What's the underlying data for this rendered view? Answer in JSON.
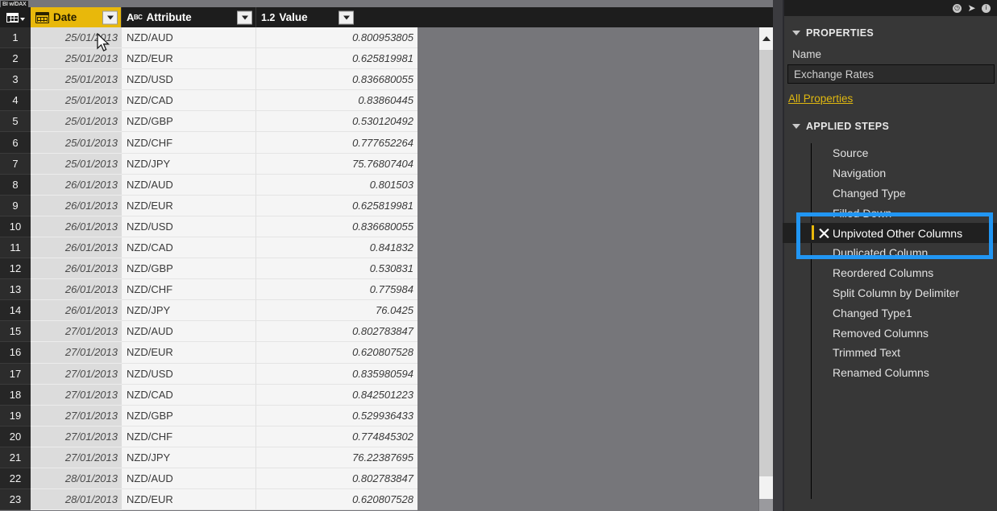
{
  "watermark": "BI w/DAX",
  "grid": {
    "columns": [
      {
        "name": "Date",
        "type_icon": "calendar-icon",
        "type_label": "",
        "selected": true
      },
      {
        "name": "Attribute",
        "type_icon": "abc-text-icon",
        "type_label": "ABC",
        "selected": false
      },
      {
        "name": "Value",
        "type_icon": "decimal-number-icon",
        "type_label": "1.2",
        "selected": false
      }
    ],
    "rows": [
      {
        "n": "1",
        "date": "25/01/2013",
        "attribute": "NZD/AUD",
        "value": "0.800953805"
      },
      {
        "n": "2",
        "date": "25/01/2013",
        "attribute": "NZD/EUR",
        "value": "0.625819981"
      },
      {
        "n": "3",
        "date": "25/01/2013",
        "attribute": "NZD/USD",
        "value": "0.836680055"
      },
      {
        "n": "4",
        "date": "25/01/2013",
        "attribute": "NZD/CAD",
        "value": "0.83860445"
      },
      {
        "n": "5",
        "date": "25/01/2013",
        "attribute": "NZD/GBP",
        "value": "0.530120492"
      },
      {
        "n": "6",
        "date": "25/01/2013",
        "attribute": "NZD/CHF",
        "value": "0.777652264"
      },
      {
        "n": "7",
        "date": "25/01/2013",
        "attribute": "NZD/JPY",
        "value": "75.76807404"
      },
      {
        "n": "8",
        "date": "26/01/2013",
        "attribute": "NZD/AUD",
        "value": "0.801503"
      },
      {
        "n": "9",
        "date": "26/01/2013",
        "attribute": "NZD/EUR",
        "value": "0.625819981"
      },
      {
        "n": "10",
        "date": "26/01/2013",
        "attribute": "NZD/USD",
        "value": "0.836680055"
      },
      {
        "n": "11",
        "date": "26/01/2013",
        "attribute": "NZD/CAD",
        "value": "0.841832"
      },
      {
        "n": "12",
        "date": "26/01/2013",
        "attribute": "NZD/GBP",
        "value": "0.530831"
      },
      {
        "n": "13",
        "date": "26/01/2013",
        "attribute": "NZD/CHF",
        "value": "0.775984"
      },
      {
        "n": "14",
        "date": "26/01/2013",
        "attribute": "NZD/JPY",
        "value": "76.0425"
      },
      {
        "n": "15",
        "date": "27/01/2013",
        "attribute": "NZD/AUD",
        "value": "0.802783847"
      },
      {
        "n": "16",
        "date": "27/01/2013",
        "attribute": "NZD/EUR",
        "value": "0.620807528"
      },
      {
        "n": "17",
        "date": "27/01/2013",
        "attribute": "NZD/USD",
        "value": "0.835980594"
      },
      {
        "n": "18",
        "date": "27/01/2013",
        "attribute": "NZD/CAD",
        "value": "0.842501223"
      },
      {
        "n": "19",
        "date": "27/01/2013",
        "attribute": "NZD/GBP",
        "value": "0.529936433"
      },
      {
        "n": "20",
        "date": "27/01/2013",
        "attribute": "NZD/CHF",
        "value": "0.774845302"
      },
      {
        "n": "21",
        "date": "27/01/2013",
        "attribute": "NZD/JPY",
        "value": "76.22387695"
      },
      {
        "n": "22",
        "date": "28/01/2013",
        "attribute": "NZD/AUD",
        "value": "0.802783847"
      },
      {
        "n": "23",
        "date": "28/01/2013",
        "attribute": "NZD/EUR",
        "value": "0.620807528"
      }
    ]
  },
  "panel": {
    "titlebar_icons": [
      "history-icon",
      "share-icon",
      "info-icon"
    ],
    "properties": {
      "section_title": "PROPERTIES",
      "name_label": "Name",
      "name_value": "Exchange Rates",
      "all_properties_link": "All Properties"
    },
    "applied_steps": {
      "section_title": "APPLIED STEPS",
      "steps": [
        {
          "label": "Source",
          "selected": false,
          "deletable": false
        },
        {
          "label": "Navigation",
          "selected": false,
          "deletable": false
        },
        {
          "label": "Changed Type",
          "selected": false,
          "deletable": false
        },
        {
          "label": "Filled Down",
          "selected": false,
          "deletable": false
        },
        {
          "label": "Unpivoted Other Columns",
          "selected": true,
          "deletable": true
        },
        {
          "label": "Duplicated Column",
          "selected": false,
          "deletable": false
        },
        {
          "label": "Reordered Columns",
          "selected": false,
          "deletable": false
        },
        {
          "label": "Split Column by Delimiter",
          "selected": false,
          "deletable": false
        },
        {
          "label": "Changed Type1",
          "selected": false,
          "deletable": false
        },
        {
          "label": "Removed Columns",
          "selected": false,
          "deletable": false
        },
        {
          "label": "Trimmed Text",
          "selected": false,
          "deletable": false
        },
        {
          "label": "Renamed Columns",
          "selected": false,
          "deletable": false
        }
      ]
    }
  },
  "annotation": {
    "highlight_color": "#2196f3",
    "accent_color": "#e8b80b",
    "target_step": "Unpivoted Other Columns"
  }
}
